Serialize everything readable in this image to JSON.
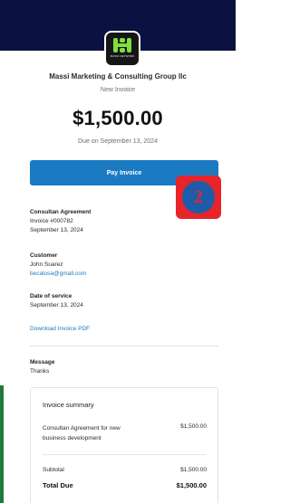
{
  "header": {
    "company_name": "Massi Marketing & Consulting Group llc",
    "subtitle": "New Invoice",
    "logo_text": "MASSI NETWORK",
    "top_bar_color": "#0b1140"
  },
  "invoice": {
    "amount": "$1,500.00",
    "due_text": "Due on September 13, 2024",
    "pay_label": "Pay Invoice",
    "pay_color": "#1a7bc3"
  },
  "overlay_badge": {
    "number": "2",
    "outer_color": "#e8242b",
    "inner_color": "#1d5ca8"
  },
  "details": {
    "agreement_title": "Consultan Agreement",
    "invoice_number": "Invoice #000782",
    "invoice_date": "September 13, 2024",
    "customer_label": "Customer",
    "customer_name": "John Suarez",
    "customer_email": "becalusa@gmail.com",
    "service_label": "Date of service",
    "service_date": "September 13, 2024",
    "download_label": "Download Invoice PDF",
    "message_label": "Message",
    "message_text": "Thanks"
  },
  "summary": {
    "title": "Invoice summary",
    "item_description": "Consultan Agreement for new business development",
    "item_amount": "$1,500.00",
    "subtotal_label": "Subtotal",
    "subtotal_amount": "$1,500.00",
    "total_label": "Total Due",
    "total_amount": "$1,500.00"
  }
}
